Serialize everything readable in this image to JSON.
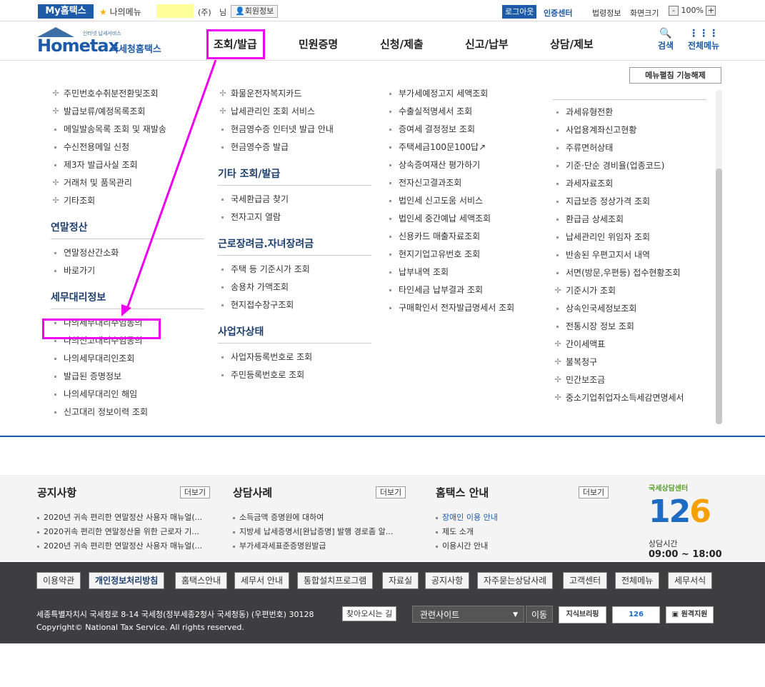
{
  "topbar": {
    "my_label": "My홈택스",
    "my_menu": "나의메뉴",
    "company": "(주)",
    "honorific": "님",
    "member_info": "회원정보",
    "logout": "로그아웃",
    "cert_center": "인증센터",
    "law_info": "법령정보",
    "screen_size": "화면크기",
    "zoom_minus": "-",
    "zoom_value": "100%",
    "zoom_plus": "+"
  },
  "header": {
    "logo_small": "인터넷 납세서비스",
    "logo_main": "Hometax",
    "logo_sub": "국세청홈택스",
    "gnb": [
      "조회/발급",
      "민원증명",
      "신청/제출",
      "신고/납부",
      "상담/제보"
    ],
    "search": "검색",
    "all_menu": "전체메뉴"
  },
  "dropdown": {
    "fold_button": "메뉴펼침 기능해제",
    "col1": {
      "items_top": [
        "주민번호수취분전환및조회",
        "발급보류/예정목록조회",
        "메일발송목록 조회 및 재발송",
        "수신전용메일 신청",
        "제3자 발급사실 조회",
        "거래처 및 품목관리",
        "기타조회"
      ],
      "section1": "연말정산",
      "items_s1": [
        "연말정산간소화",
        "바로가기"
      ],
      "section2": "세무대리정보",
      "items_s2": [
        "나의세무대리수임동의",
        "나의신고대리수임동의",
        "나의세무대리인조회",
        "발급된 증명정보",
        "나의세무대리인 해임",
        "신고대리 정보이력 조회"
      ]
    },
    "col2": {
      "items_top": [
        "화물운전자복지카드",
        "납세관리인 조회 서비스",
        "현금영수증 인터넷 발급 안내",
        "현금영수증 발급"
      ],
      "section1": "기타 조회/발급",
      "items_s1": [
        "국세환급금 찾기",
        "전자고지 열람"
      ],
      "section2": "근로장려금.자녀장려금",
      "items_s2": [
        "주택 등 기준시가 조회",
        "송용차 가액조회",
        "현지접수창구조회"
      ],
      "section3": "사업자상태",
      "items_s3": [
        "사업자등록번호로 조회",
        "주민등록번호로 조회"
      ]
    },
    "col3": {
      "items": [
        "부가세예정고지 세액조회",
        "수출실적명세서 조회",
        "증여세 결정정보 조회",
        "주택세금100문100답",
        "상속증여재산 평가하기",
        "전자신고결과조회",
        "법인세 신고도움 서비스",
        "법인세 중간예납 세액조회",
        "신용카드 매출자료조회",
        "현지기업고유번호 조회",
        "납부내역 조회",
        "타인세금 납부결과 조회",
        "구매확인서 전자발급명세서 조회"
      ]
    },
    "col4": {
      "items": [
        "과세유형전환",
        "사업용계좌신고현황",
        "주류면허상태",
        "기준·단순 경비율(업종코드)",
        "과세자료조회",
        "지급보증 정상가격 조회",
        "환급금 상세조회",
        "납세관리인 위임자 조회",
        "반송된 우편고지서 내역",
        "서면(방문,우편등) 접수현황조회",
        "기준시가 조회",
        "상속인국세정보조회",
        "전통시장 정보 조회",
        "간이세액표",
        "불복청구",
        "민간보조금",
        "중소기업취업자소득세감면명세서"
      ]
    }
  },
  "notices": {
    "notice_title": "공지사항",
    "notice_more": "더보기",
    "notice_items": [
      "2020년 귀속 편리한 연말정산 사용자 매뉴얼(...",
      "2020귀속 편리한 연말정산을 위한 근로자 기...",
      "2020년 귀속 편리한 연말정산 사용자 매뉴얼(..."
    ],
    "case_title": "상담사례",
    "case_more": "더보기",
    "case_items": [
      "소득금액 증명원에 대하여",
      "지방세 납세증명서[완납증명] 발행 경로좀 알...",
      "부가세과세표준증명원발급"
    ],
    "guide_title": "홈택스 안내",
    "guide_more": "더보기",
    "guide_items": [
      "장애인 이용 안내",
      "제도 소개",
      "이용시간 안내"
    ],
    "center_top": "국세상담센터",
    "center_num_a": "12",
    "center_num_b": "6",
    "center_label": "상담시간",
    "center_time": "09:00 ~ 18:00"
  },
  "footer": {
    "links": [
      "이용약관",
      "개인정보처리방침",
      "홈택스안내",
      "세무서 안내",
      "통합설치프로그램",
      "자료실",
      "공지사항",
      "자주묻는상담사례",
      "고객센터",
      "전체메뉴",
      "세무서식"
    ],
    "address": "세종특별자치시 국세청로 8-14 국세청(정부세종2청사 국세청동) (우편번호) 30128",
    "find_route": "찾아오시는 길",
    "copyright": "Copyright© National Tax Service. All rights reserved.",
    "related_site": "관련사이트",
    "go": "이동",
    "banner1": "지식브리핑",
    "banner2": "126",
    "banner3": "원격지원"
  },
  "colors": {
    "brand": "#1d5aa8",
    "highlight": "#ee00ee",
    "footer_bg": "#3e3e40"
  }
}
